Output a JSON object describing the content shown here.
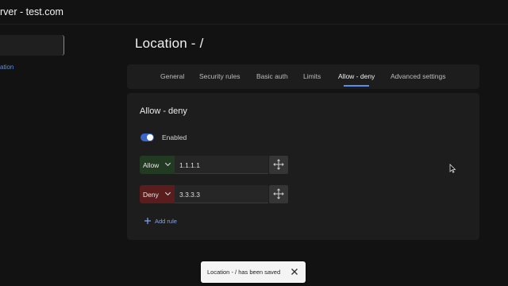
{
  "app": {
    "title": "rver - test.com"
  },
  "sidebar": {
    "link_label": "ation"
  },
  "page": {
    "title": "Location - /"
  },
  "tabs": [
    {
      "label": "General",
      "active": false
    },
    {
      "label": "Security rules",
      "active": false
    },
    {
      "label": "Basic auth",
      "active": false
    },
    {
      "label": "Limits",
      "active": false
    },
    {
      "label": "Allow - deny",
      "active": true
    },
    {
      "label": "Advanced settings",
      "active": false
    }
  ],
  "panel": {
    "title": "Allow - deny",
    "toggle_label": "Enabled",
    "toggle_on": true,
    "rules": [
      {
        "action": "Allow",
        "value": "1.1.1.1"
      },
      {
        "action": "Deny",
        "value": "3.3.3.3"
      }
    ],
    "add_rule_label": "Add rule"
  },
  "snackbar": {
    "message": "Location - / has been saved"
  },
  "colors": {
    "accent": "#5a8dee",
    "allow_bg": "#223a22",
    "deny_bg": "#5a1c1c",
    "background": "#121212",
    "card": "#1d1d1d"
  },
  "icons": [
    "chevron-down-icon",
    "move-icon",
    "plus-icon",
    "close-icon",
    "mouse-cursor-icon"
  ]
}
